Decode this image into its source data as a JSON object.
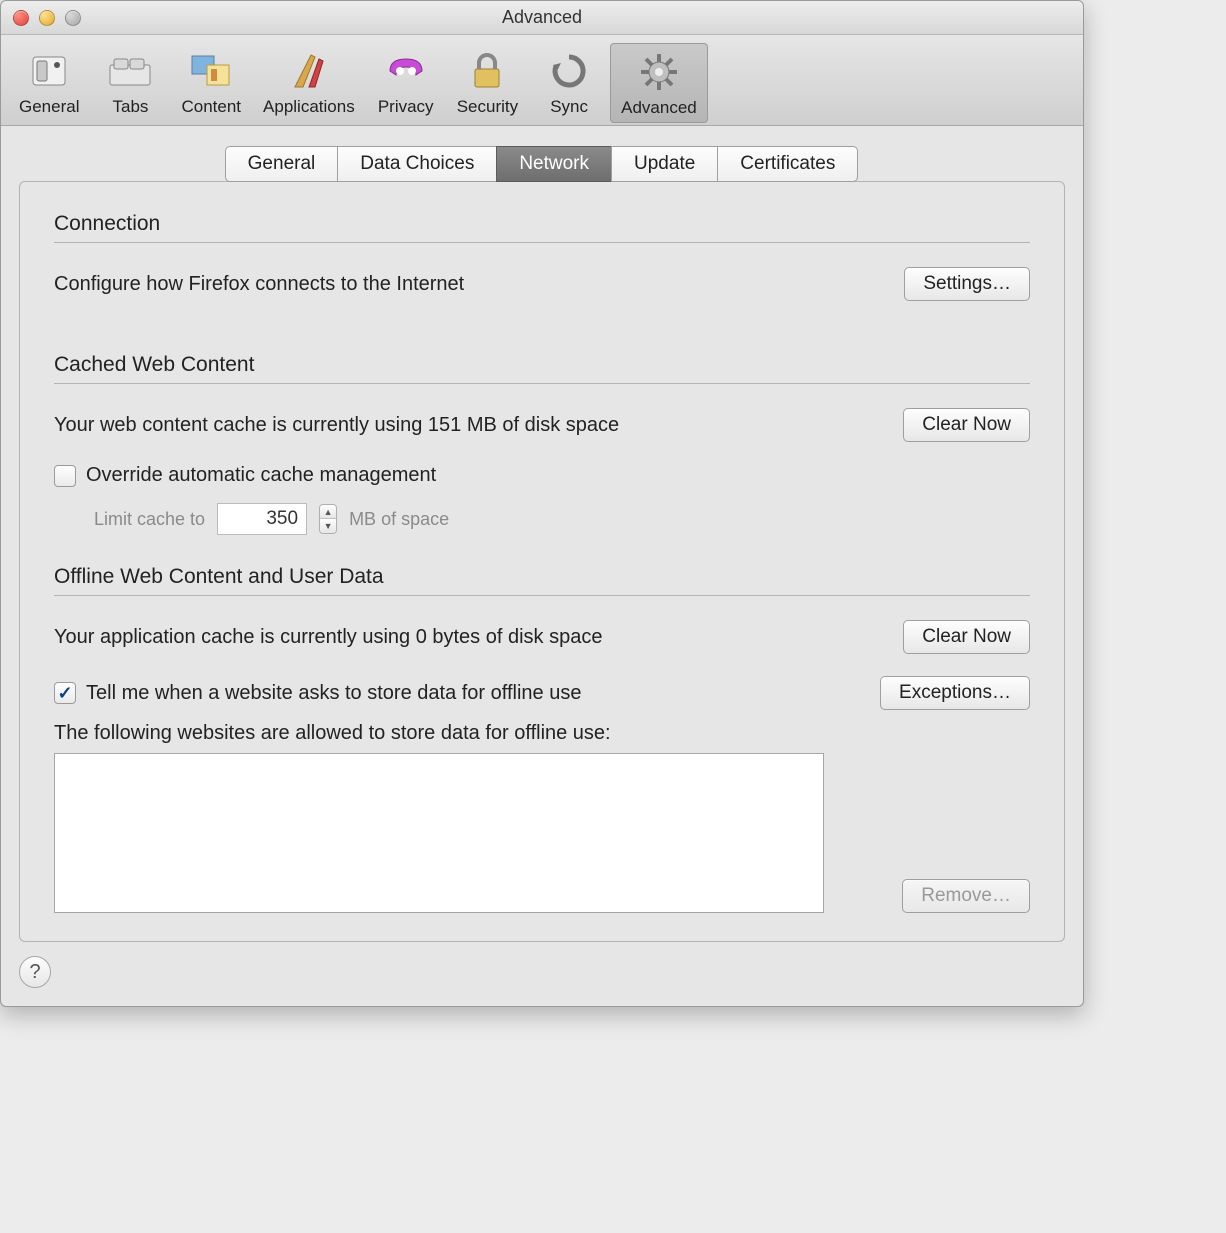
{
  "window": {
    "title": "Advanced"
  },
  "toolbar": {
    "items": [
      {
        "label": "General",
        "icon": "switch-icon"
      },
      {
        "label": "Tabs",
        "icon": "tabs-icon"
      },
      {
        "label": "Content",
        "icon": "content-icon"
      },
      {
        "label": "Applications",
        "icon": "applications-icon"
      },
      {
        "label": "Privacy",
        "icon": "privacy-icon"
      },
      {
        "label": "Security",
        "icon": "security-icon"
      },
      {
        "label": "Sync",
        "icon": "sync-icon"
      },
      {
        "label": "Advanced",
        "icon": "advanced-icon",
        "selected": true
      }
    ]
  },
  "tabs": {
    "items": [
      "General",
      "Data Choices",
      "Network",
      "Update",
      "Certificates"
    ],
    "active": "Network"
  },
  "connection": {
    "heading": "Connection",
    "text": "Configure how Firefox connects to the Internet",
    "settings_btn": "Settings…"
  },
  "cache": {
    "heading": "Cached Web Content",
    "usage_text": "Your web content cache is currently using 151 MB of disk space",
    "clear_btn": "Clear Now",
    "override_label": "Override automatic cache management",
    "override_checked": false,
    "limit_prefix": "Limit cache to",
    "limit_value": "350",
    "limit_suffix": "MB of space"
  },
  "offline": {
    "heading": "Offline Web Content and User Data",
    "usage_text": "Your application cache is currently using 0 bytes of disk space",
    "clear_btn": "Clear Now",
    "tell_label": "Tell me when a website asks to store data for offline use",
    "tell_checked": true,
    "exceptions_btn": "Exceptions…",
    "list_label": "The following websites are allowed to store data for offline use:",
    "remove_btn": "Remove…"
  },
  "help_tooltip": "?"
}
